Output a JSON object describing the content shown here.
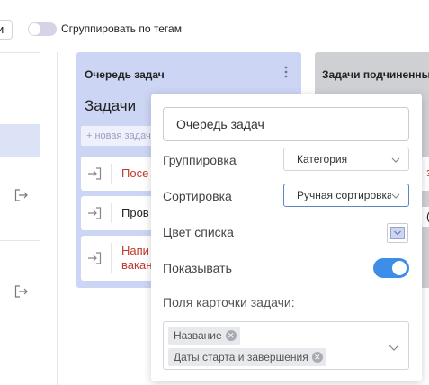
{
  "topbar": {
    "cut_button_label": "и",
    "group_by_tags": {
      "label": "Сгруппировать по тегам",
      "enabled": false
    }
  },
  "column": {
    "title": "Очередь задач",
    "heading": "Задачи",
    "new_task_placeholder": "+ новая задача",
    "tasks": [
      {
        "text": "Посе",
        "color": "#c0392b"
      },
      {
        "text": "Пров",
        "color": "#222222"
      },
      {
        "text": "Напи\nвакан",
        "color": "#c0392b"
      }
    ]
  },
  "column2": {
    "title": "Задачи подчиненных"
  },
  "settings": {
    "name_value": "Очередь задач",
    "grouping": {
      "label": "Группировка",
      "value": "Категория"
    },
    "sorting": {
      "label": "Сортировка",
      "value": "Ручная сортировка"
    },
    "list_color": {
      "label": "Цвет списка",
      "color": "#cdd5f5"
    },
    "show": {
      "label": "Показывать",
      "enabled": true
    },
    "card_fields": {
      "label": "Поля карточки задачи:",
      "tags": [
        "Название",
        "Даты старта и завершения"
      ]
    }
  },
  "colors": {
    "accent": "#3d8ee6",
    "column_bg": "#cdd5f5",
    "sidebar_active": "#dde3f6"
  }
}
